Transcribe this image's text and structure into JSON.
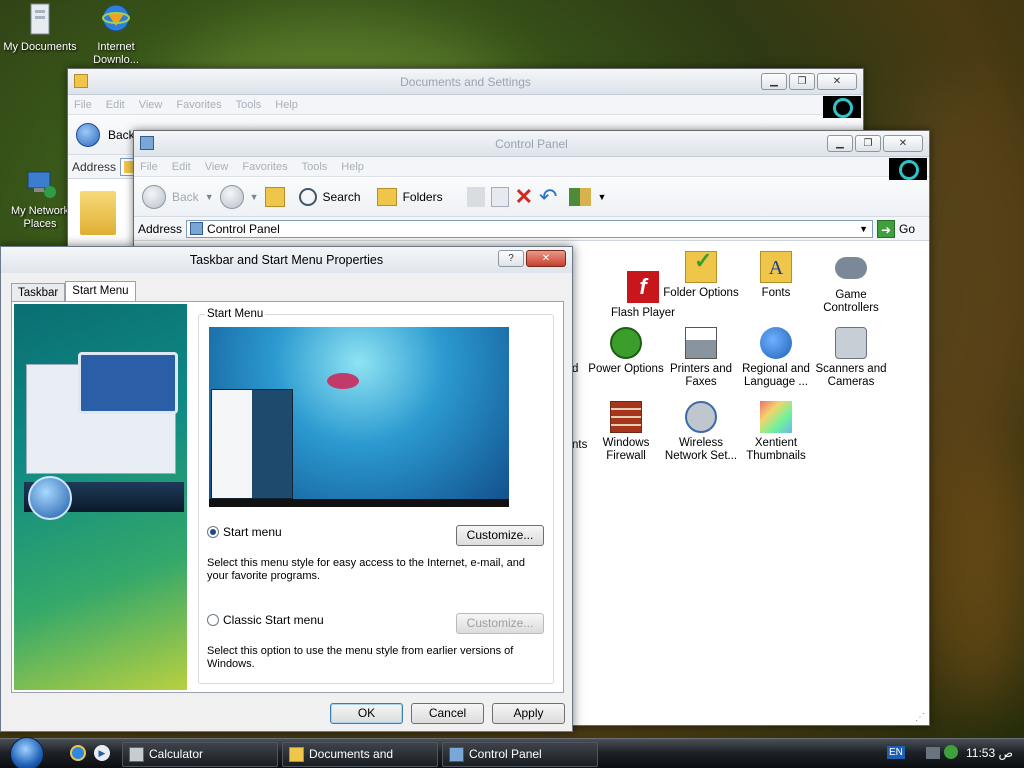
{
  "desktop": {
    "icons": [
      {
        "label": "My Documents"
      },
      {
        "label": "Internet Downlo..."
      },
      {
        "label": "My Network Places"
      }
    ]
  },
  "docs_window": {
    "title": "Documents and Settings",
    "menu": [
      "File",
      "Edit",
      "View",
      "Favorites",
      "Tools",
      "Help"
    ],
    "back_label": "Back",
    "address_label": "Address"
  },
  "cp_window": {
    "title": "Control Panel",
    "menu": [
      "File",
      "Edit",
      "View",
      "Favorites",
      "Tools",
      "Help"
    ],
    "back_label": "Back",
    "search_label": "Search",
    "folders_label": "Folders",
    "address_label": "Address",
    "address_value": "Control Panel",
    "go_label": "Go",
    "items": [
      {
        "label": "Flash Player"
      },
      {
        "label": "Folder Options"
      },
      {
        "label": "Fonts"
      },
      {
        "label": "Game Controllers"
      },
      {
        "label": "Power Options"
      },
      {
        "label": "Printers and Faxes"
      },
      {
        "label": "Regional and Language ..."
      },
      {
        "label": "Scanners and Cameras"
      },
      {
        "label": "Windows Firewall"
      },
      {
        "label": "Wireless Network Set..."
      },
      {
        "label": "Xentient Thumbnails"
      }
    ],
    "partial_left_text_1": "d",
    "partial_left_text_2": "nts"
  },
  "dialog": {
    "title": "Taskbar and Start Menu Properties",
    "help_btn": "?",
    "tabs": [
      "Taskbar",
      "Start Menu"
    ],
    "group_label": "Start Menu",
    "start_menu_option": "Start menu",
    "start_menu_desc": "Select this menu style for easy access to the Internet, e-mail, and your favorite programs.",
    "classic_option": "Classic Start menu",
    "classic_desc": "Select this option to use the menu style from earlier versions of Windows.",
    "customize_label": "Customize...",
    "ok_label": "OK",
    "cancel_label": "Cancel",
    "apply_label": "Apply"
  },
  "taskbar": {
    "tasks": [
      {
        "label": "Calculator"
      },
      {
        "label": "Documents and Settings"
      },
      {
        "label": "Control Panel"
      }
    ],
    "lang": "EN",
    "clock": "11:53 ص"
  },
  "colors": {
    "taskbar": "#1e2228",
    "accent": "#1c4a8c",
    "close_red": "#c8412c"
  }
}
